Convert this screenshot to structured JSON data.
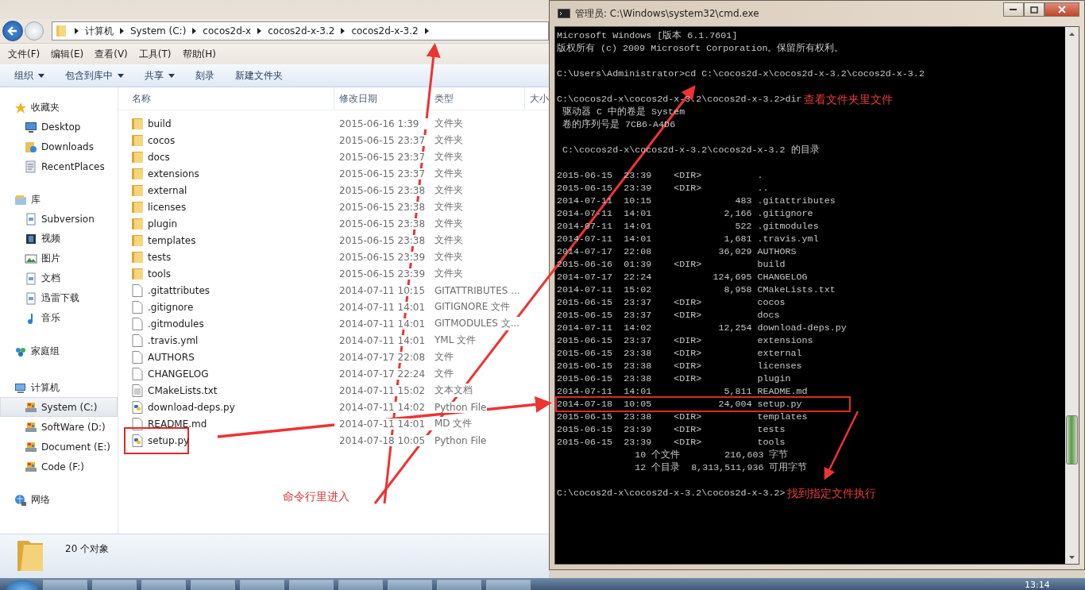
{
  "explorer": {
    "address": [
      "计算机",
      "System (C:)",
      "cocos2d-x",
      "cocos2d-x-3.2",
      "cocos2d-x-3.2"
    ],
    "menu": [
      "文件(F)",
      "编辑(E)",
      "查看(V)",
      "工具(T)",
      "帮助(H)"
    ],
    "toolbar": [
      {
        "label": "组织",
        "dropdown": true
      },
      {
        "label": "包含到库中",
        "dropdown": true
      },
      {
        "label": "共享",
        "dropdown": true
      },
      {
        "label": "刻录",
        "dropdown": false
      },
      {
        "label": "新建文件夹",
        "dropdown": false
      }
    ],
    "sidebar": [
      {
        "label": "收藏夹",
        "kind": "star",
        "children": [
          {
            "label": "Desktop",
            "kind": "monitor",
            "selected": false
          },
          {
            "label": "Downloads",
            "kind": "download",
            "selected": false
          },
          {
            "label": "RecentPlaces",
            "kind": "recent",
            "selected": false
          }
        ]
      },
      {
        "label": "库",
        "kind": "library",
        "children": [
          {
            "label": "Subversion",
            "kind": "doc",
            "selected": false
          },
          {
            "label": "视频",
            "kind": "film",
            "selected": false
          },
          {
            "label": "图片",
            "kind": "image",
            "selected": false
          },
          {
            "label": "文档",
            "kind": "doc",
            "selected": false
          },
          {
            "label": "迅雷下载",
            "kind": "doc",
            "selected": false
          },
          {
            "label": "音乐",
            "kind": "music",
            "selected": false
          }
        ]
      },
      {
        "label": "家庭组",
        "kind": "homegroup"
      },
      {
        "label": "计算机",
        "kind": "computer",
        "children": [
          {
            "label": "System (C:)",
            "kind": "drive",
            "selected": true
          },
          {
            "label": "SoftWare (D:)",
            "kind": "drive",
            "selected": false
          },
          {
            "label": "Document (E:)",
            "kind": "drive",
            "selected": false
          },
          {
            "label": "Code (F:)",
            "kind": "drive",
            "selected": false
          }
        ]
      },
      {
        "label": "网络",
        "kind": "network"
      }
    ],
    "columns": [
      "名称",
      "修改日期",
      "类型",
      "大小"
    ],
    "files": [
      {
        "name": "build",
        "date": "2015-06-16 1:39",
        "type": "文件夹",
        "kind": "folder",
        "highlighted": false
      },
      {
        "name": "cocos",
        "date": "2015-06-15 23:37",
        "type": "文件夹",
        "kind": "folder",
        "highlighted": false
      },
      {
        "name": "docs",
        "date": "2015-06-15 23:37",
        "type": "文件夹",
        "kind": "folder",
        "highlighted": false
      },
      {
        "name": "extensions",
        "date": "2015-06-15 23:37",
        "type": "文件夹",
        "kind": "folder",
        "highlighted": false
      },
      {
        "name": "external",
        "date": "2015-06-15 23:38",
        "type": "文件夹",
        "kind": "folder",
        "highlighted": false
      },
      {
        "name": "licenses",
        "date": "2015-06-15 23:38",
        "type": "文件夹",
        "kind": "folder",
        "highlighted": false
      },
      {
        "name": "plugin",
        "date": "2015-06-15 23:38",
        "type": "文件夹",
        "kind": "folder",
        "highlighted": false
      },
      {
        "name": "templates",
        "date": "2015-06-15 23:38",
        "type": "文件夹",
        "kind": "folder",
        "highlighted": false
      },
      {
        "name": "tests",
        "date": "2015-06-15 23:39",
        "type": "文件夹",
        "kind": "folder",
        "highlighted": false
      },
      {
        "name": "tools",
        "date": "2015-06-15 23:39",
        "type": "文件夹",
        "kind": "folder",
        "highlighted": false
      },
      {
        "name": ".gitattributes",
        "date": "2014-07-11 10:15",
        "type": "GITATTRIBUTES ...",
        "kind": "file",
        "highlighted": false
      },
      {
        "name": ".gitignore",
        "date": "2014-07-11 14:01",
        "type": "GITIGNORE 文件",
        "kind": "file",
        "highlighted": false
      },
      {
        "name": ".gitmodules",
        "date": "2014-07-11 14:01",
        "type": "GITMODULES 文...",
        "kind": "file",
        "highlighted": false
      },
      {
        "name": ".travis.yml",
        "date": "2014-07-11 14:01",
        "type": "YML 文件",
        "kind": "file",
        "highlighted": false
      },
      {
        "name": "AUTHORS",
        "date": "2014-07-17 22:08",
        "type": "文件",
        "kind": "file",
        "highlighted": false
      },
      {
        "name": "CHANGELOG",
        "date": "2014-07-17 22:24",
        "type": "文件",
        "kind": "file",
        "highlighted": false
      },
      {
        "name": "CMakeLists.txt",
        "date": "2014-07-11 15:02",
        "type": "文本文档",
        "kind": "text",
        "highlighted": false
      },
      {
        "name": "download-deps.py",
        "date": "2014-07-11 14:02",
        "type": "Python File",
        "kind": "python",
        "highlighted": false
      },
      {
        "name": "README.md",
        "date": "2014-07-11 14:01",
        "type": "MD 文件",
        "kind": "file",
        "highlighted": false
      },
      {
        "name": "setup.py",
        "date": "2014-07-18 10:05",
        "type": "Python File",
        "kind": "python",
        "highlighted": true
      }
    ],
    "status": "20 个对象"
  },
  "console": {
    "title": "管理员: C:\\Windows\\system32\\cmd.exe",
    "blocks": [
      {
        "lines": [
          {
            "text": "Microsoft Windows [版本 6.1.7601]"
          },
          {
            "text": "版权所有 (c) 2009 Microsoft Corporation。保留所有权利。"
          }
        ]
      },
      {
        "lines": [
          {
            "text": "C:\\Users\\Administrator>cd C:\\cocos2d-x\\cocos2d-x-3.2\\cocos2d-x-3.2"
          }
        ]
      },
      {
        "lines": [
          {
            "text": "C:\\cocos2d-x\\cocos2d-x-3.2\\cocos2d-x-3.2>dir",
            "note": "查看文件夹里文件"
          },
          {
            "text": " 驱动器 C 中的卷是 System"
          },
          {
            "text": " 卷的序列号是 7CB6-A4D6"
          }
        ]
      },
      {
        "lines": [
          {
            "text": " C:\\cocos2d-x\\cocos2d-x-3.2\\cocos2d-x-3.2 的目录"
          }
        ]
      },
      {
        "lines": [
          {
            "text": "2015-06-15  23:39    <DIR>          .",
            "highlighted": false
          },
          {
            "text": "2015-06-15  23:39    <DIR>          ..",
            "highlighted": false
          },
          {
            "text": "2014-07-11  10:15               483 .gitattributes",
            "highlighted": false
          },
          {
            "text": "2014-07-11  14:01             2,166 .gitignore",
            "highlighted": false
          },
          {
            "text": "2014-07-11  14:01               522 .gitmodules",
            "highlighted": false
          },
          {
            "text": "2014-07-11  14:01             1,681 .travis.yml",
            "highlighted": false
          },
          {
            "text": "2014-07-17  22:08            36,029 AUTHORS",
            "highlighted": false
          },
          {
            "text": "2015-06-16  01:39    <DIR>          build",
            "highlighted": false
          },
          {
            "text": "2014-07-17  22:24           124,695 CHANGELOG",
            "highlighted": false
          },
          {
            "text": "2014-07-11  15:02             8,958 CMakeLists.txt",
            "highlighted": false
          },
          {
            "text": "2015-06-15  23:37    <DIR>          cocos",
            "highlighted": false
          },
          {
            "text": "2015-06-15  23:37    <DIR>          docs",
            "highlighted": false
          },
          {
            "text": "2014-07-11  14:02            12,254 download-deps.py",
            "highlighted": false
          },
          {
            "text": "2015-06-15  23:37    <DIR>          extensions",
            "highlighted": false
          },
          {
            "text": "2015-06-15  23:38    <DIR>          external",
            "highlighted": false
          },
          {
            "text": "2015-06-15  23:38    <DIR>          licenses",
            "highlighted": false
          },
          {
            "text": "2015-06-15  23:38    <DIR>          plugin",
            "highlighted": false
          },
          {
            "text": "2014-07-11  14:01             5,811 README.md",
            "highlighted": false
          },
          {
            "text": "2014-07-18  10:05            24,004 setup.py",
            "highlighted": true
          },
          {
            "text": "2015-06-15  23:38    <DIR>          templates",
            "highlighted": false
          },
          {
            "text": "2015-06-15  23:39    <DIR>          tests",
            "highlighted": false
          },
          {
            "text": "2015-06-15  23:39    <DIR>          tools",
            "highlighted": false
          },
          {
            "text": "              10 个文件        216,603 字节",
            "highlighted": false
          },
          {
            "text": "              12 个目录  8,313,511,936 可用字节",
            "highlighted": false
          }
        ]
      },
      {
        "lines": [
          {
            "text": "C:\\cocos2d-x\\cocos2d-x-3.2\\cocos2d-x-3.2>",
            "note": "找到指定文件执行"
          }
        ]
      }
    ]
  },
  "annotation": {
    "label": "命令行里进入"
  },
  "taskbar": {
    "clock": "13:14"
  }
}
